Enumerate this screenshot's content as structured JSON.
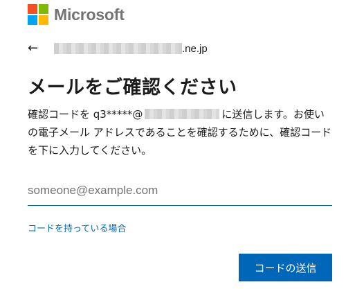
{
  "brand": {
    "name": "Microsoft",
    "logo_colors": [
      "#f25022",
      "#7fba00",
      "#00a4ef",
      "#ffb900"
    ]
  },
  "identity": {
    "back_icon": "back-arrow-icon",
    "email_suffix": ".ne.jp"
  },
  "title": "メールをご確認ください",
  "description": {
    "part1": "確認コードを q3*****@",
    "part2": "に送信します。お使いの電子メール アドレスであることを確認するために、確認コードを下に入力してください。"
  },
  "input": {
    "value": "",
    "placeholder": "someone@example.com"
  },
  "link": "コードを持っている場合",
  "button": "コードの送信",
  "colors": {
    "accent": "#0067b8",
    "text": "#1b1b1b",
    "logo_text": "#737373"
  }
}
